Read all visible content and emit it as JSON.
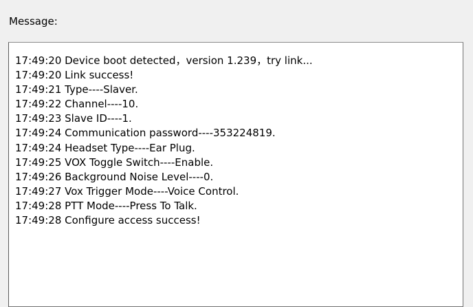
{
  "panel": {
    "label": "Message:"
  },
  "log": {
    "lines": [
      "17:49:20 Device boot detected，version 1.239，try link...",
      "17:49:20 Link success!",
      "17:49:21 Type----Slaver.",
      "17:49:22 Channel----10.",
      "17:49:23 Slave ID----1.",
      "17:49:24 Communication password----353224819.",
      "17:49:24 Headset Type----Ear Plug.",
      "17:49:25 VOX Toggle Switch----Enable.",
      "17:49:26 Background Noise Level----0.",
      "17:49:27 Vox Trigger Mode----Voice Control.",
      "17:49:28 PTT Mode----Press To Talk.",
      "17:49:28 Configure access success!"
    ]
  }
}
